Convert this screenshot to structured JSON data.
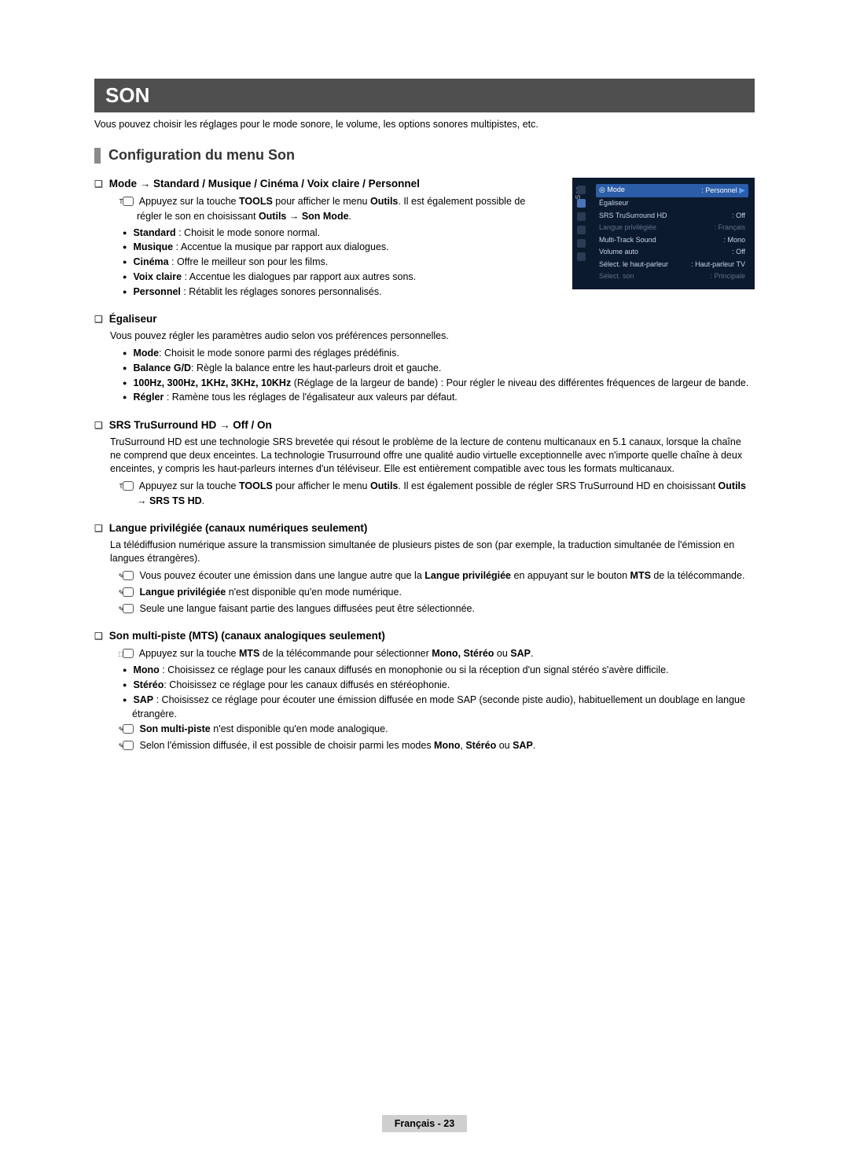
{
  "title": "SON",
  "intro": "Vous pouvez choisir les réglages pour le mode sonore, le volume, les options sonores multipistes, etc.",
  "section_heading": "Configuration du menu Son",
  "osd": {
    "vlabel": "Son",
    "rows": [
      {
        "label": "Mode",
        "value": ": Personnel",
        "highlight": true,
        "arrow": true
      },
      {
        "label": "Égaliseur",
        "value": ""
      },
      {
        "label": "SRS TruSurround HD",
        "value": ": Off"
      },
      {
        "label": "Langue privilégiée",
        "value": ": Français",
        "dim": true
      },
      {
        "label": "Multi-Track Sound",
        "value": ": Mono"
      },
      {
        "label": "Volume auto",
        "value": ": Off"
      },
      {
        "label": "Sélect. le haut-parleur",
        "value": ": Haut-parleur TV"
      },
      {
        "label": "Sélect. son",
        "value": ": Principale",
        "dim": true
      }
    ]
  },
  "mode": {
    "title": "Mode → Standard / Musique / Cinéma / Voix claire / Personnel",
    "tip_prefix": "Appuyez sur la touche ",
    "tip_bold1": "TOOLS",
    "tip_mid": " pour afficher le menu ",
    "tip_bold2": "Outils",
    "tip_suffix": ". Il est également possible de régler le son en choisissant ",
    "tip_bold3": "Outils → Son Mode",
    "tip_end": ".",
    "items": [
      {
        "b": "Standard",
        "t": " : Choisit le mode sonore normal."
      },
      {
        "b": "Musique",
        "t": " : Accentue la musique par rapport aux dialogues."
      },
      {
        "b": "Cinéma",
        "t": " : Offre le meilleur son pour les films."
      },
      {
        "b": "Voix claire",
        "t": " : Accentue les dialogues par rapport aux autres sons."
      },
      {
        "b": "Personnel",
        "t": " : Rétablit les réglages sonores personnalisés."
      }
    ]
  },
  "egaliseur": {
    "title": "Égaliseur",
    "desc": "Vous pouvez régler les paramètres audio selon vos préférences personnelles.",
    "items": [
      {
        "b": "Mode",
        "t": ": Choisit le mode sonore parmi des réglages prédéfinis."
      },
      {
        "b": "Balance G/D",
        "t": ": Règle la balance entre les haut-parleurs droit et gauche."
      },
      {
        "b": "100Hz, 300Hz, 1KHz, 3KHz, 10KHz",
        "t": " (Réglage de la largeur de bande) : Pour régler le niveau des différentes fréquences de largeur de bande."
      },
      {
        "b": "Régler",
        "t": " : Ramène tous les réglages de l'égalisateur aux valeurs par défaut."
      }
    ]
  },
  "srs": {
    "title": "SRS TruSurround HD → Off / On",
    "desc": "TruSurround HD est une technologie SRS brevetée qui résout le problème de la lecture de contenu multicanaux en 5.1 canaux, lorsque la chaîne ne comprend que deux enceintes. La technologie Trusurround offre une qualité audio virtuelle exceptionnelle avec n'importe quelle chaîne à deux enceintes, y compris les haut-parleurs internes d'un téléviseur. Elle est entièrement compatible avec tous les formats multicanaux.",
    "tip_prefix": "Appuyez sur la touche ",
    "tip_b1": "TOOLS",
    "tip_mid": " pour afficher le menu ",
    "tip_b2": "Outils",
    "tip_suffix": ". Il est également possible de régler SRS TruSurround HD en choisissant ",
    "tip_b3": "Outils → SRS TS HD",
    "tip_end": "."
  },
  "langue": {
    "title": "Langue privilégiée (canaux numériques seulement)",
    "desc": "La télédiffusion numérique assure la transmission simultanée de plusieurs pistes de son (par exemple, la traduction simultanée de l'émission en langues étrangères).",
    "n1_a": "Vous pouvez écouter une émission dans une langue autre que la ",
    "n1_b": "Langue privilégiée",
    "n1_c": " en appuyant sur le bouton ",
    "n1_d": "MTS",
    "n1_e": " de la télécommande.",
    "n2_b": "Langue privilégiée",
    "n2_t": " n'est disponible qu'en mode numérique.",
    "n3": "Seule une langue faisant partie des langues diffusées peut être sélectionnée."
  },
  "mts": {
    "title": "Son multi-piste (MTS) (canaux analogiques seulement)",
    "t1_a": "Appuyez sur la touche ",
    "t1_b": "MTS",
    "t1_c": " de la télécommande pour sélectionner ",
    "t1_d": "Mono, Stéréo",
    "t1_e": " ou ",
    "t1_f": "SAP",
    "t1_g": ".",
    "items": [
      {
        "b": "Mono",
        "t": " : Choisissez ce réglage pour les canaux diffusés en monophonie ou si la réception d'un signal stéréo s'avère difficile."
      },
      {
        "b": "Stéréo",
        "t": ": Choisissez ce réglage pour les canaux diffusés en stéréophonie."
      },
      {
        "b": "SAP",
        "t": " : Choisissez ce réglage pour écouter une émission diffusée en mode SAP (seconde piste audio), habituellement un doublage en langue étrangère."
      }
    ],
    "n1_b": "Son multi-piste",
    "n1_t": " n'est disponible qu'en mode analogique.",
    "n2_a": "Selon l'émission diffusée, il est possible de choisir parmi les modes ",
    "n2_b": "Mono",
    "n2_c": ", ",
    "n2_d": "Stéréo",
    "n2_e": " ou ",
    "n2_f": "SAP",
    "n2_g": "."
  },
  "footer": "Français - 23"
}
